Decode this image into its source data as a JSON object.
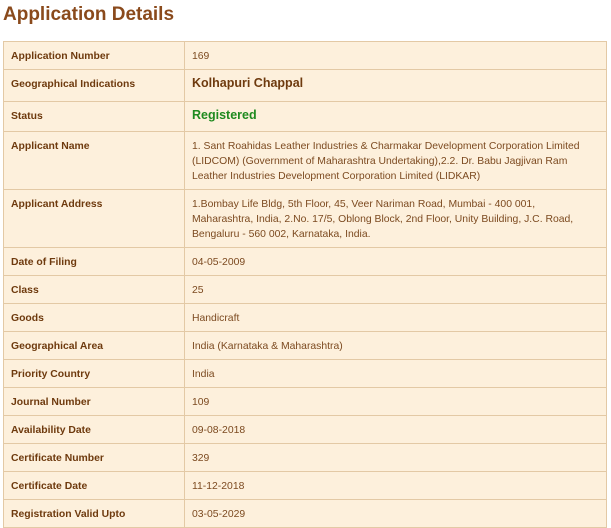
{
  "page": {
    "title": "Application Details"
  },
  "rows": [
    {
      "label": "Application Number",
      "value": "169"
    },
    {
      "label": "Geographical Indications",
      "value": "Kolhapuri Chappal"
    },
    {
      "label": "Status",
      "value": "Registered"
    },
    {
      "label": "Applicant Name",
      "value": "1. Sant Roahidas Leather Industries & Charmakar Development Corporation Limited (LIDCOM) (Government of Maharashtra Undertaking),2.2. Dr. Babu Jagjivan Ram Leather Industries Development Corporation Limited (LIDKAR)"
    },
    {
      "label": "Applicant Address",
      "value": "1.Bombay Life Bldg, 5th Floor, 45, Veer Nariman Road, Mumbai - 400 001, Maharashtra, India, 2.No. 17/5, Oblong Block, 2nd Floor, Unity Building, J.C. Road, Bengaluru - 560 002, Karnataka, India."
    },
    {
      "label": "Date of Filing",
      "value": "04-05-2009"
    },
    {
      "label": "Class",
      "value": "25"
    },
    {
      "label": "Goods",
      "value": "Handicraft"
    },
    {
      "label": "Geographical Area",
      "value": "India (Karnataka & Maharashtra)"
    },
    {
      "label": "Priority Country",
      "value": "India"
    },
    {
      "label": "Journal Number",
      "value": "109"
    },
    {
      "label": "Availability Date",
      "value": "09-08-2018"
    },
    {
      "label": "Certificate Number",
      "value": "329"
    },
    {
      "label": "Certificate Date",
      "value": "11-12-2018"
    },
    {
      "label": "Registration Valid Upto",
      "value": "03-05-2029"
    }
  ],
  "colors": {
    "title": "#8a4a1c",
    "table_background": "#fdf0dc",
    "table_border": "#e3c9a5",
    "status_registered": "#1f8a1f"
  }
}
